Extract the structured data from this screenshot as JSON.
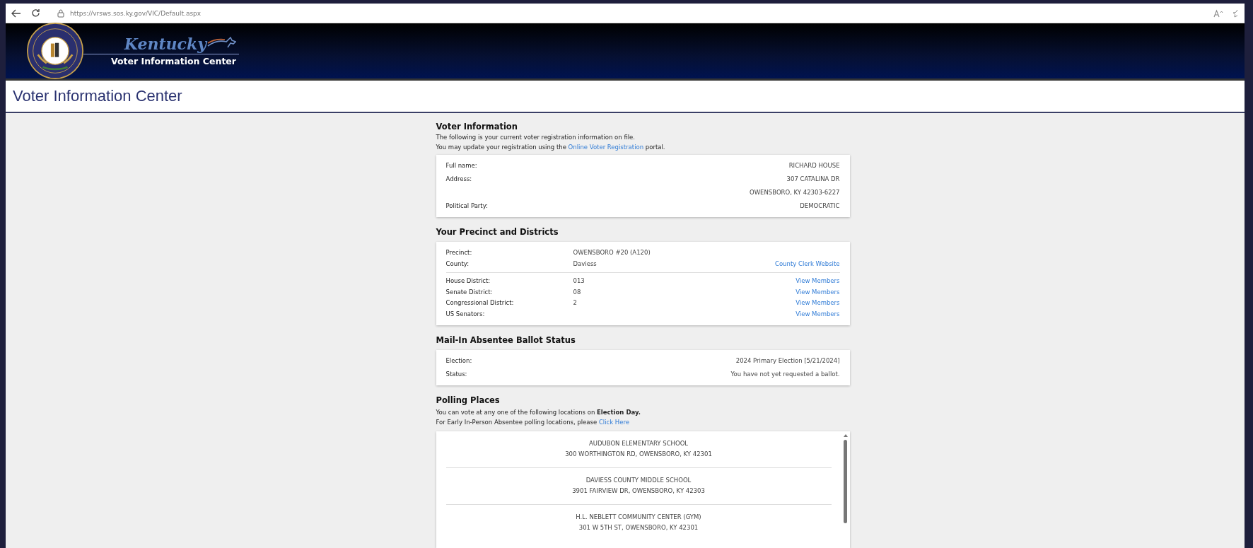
{
  "browser": {
    "url": "https://vrsws.sos.ky.gov/VIC/Default.aspx"
  },
  "header": {
    "wordmark": "Kentucky",
    "subtitle": "Voter Information Center"
  },
  "page_title": "Voter Information Center",
  "voter_information": {
    "heading": "Voter Information",
    "intro": "The following is your current voter registration information on file.",
    "update_before": "You may update your registration using the",
    "update_link": "Online Voter Registration",
    "update_after": "portal.",
    "fields": [
      {
        "label": "Full name:",
        "values": [
          "RICHARD  HOUSE"
        ]
      },
      {
        "label": "Address:",
        "values": [
          "307 CATALINA DR",
          "OWENSBORO, KY 42303-6227"
        ]
      },
      {
        "label": "Political Party:",
        "values": [
          "DEMOCRATIC"
        ]
      }
    ]
  },
  "precinct": {
    "heading": "Your Precinct and Districts",
    "groups": [
      [
        {
          "label": "Precinct:",
          "value": "OWENSBORO #20 (A120)"
        },
        {
          "label": "County:",
          "value": "Daviess",
          "link": "County Clerk Website"
        }
      ],
      [
        {
          "label": "House District:",
          "value": "013",
          "link": "View Members"
        },
        {
          "label": "Senate District:",
          "value": "08",
          "link": "View Members"
        },
        {
          "label": "Congressional District:",
          "value": "2",
          "link": "View Members"
        },
        {
          "label": "US Senators:",
          "link": "View Members"
        }
      ]
    ]
  },
  "absentee": {
    "heading": "Mail-In Absentee Ballot Status",
    "rows": [
      {
        "label": "Election:",
        "value": "2024 Primary Election [5/21/2024]"
      },
      {
        "label": "Status:",
        "value": "You have not yet requested a ballot."
      }
    ]
  },
  "polling": {
    "heading": "Polling Places",
    "intro": "You can vote at any one of the following locations on **Election Day.**",
    "early_before": "For Early In-Person Absentee polling locations, please",
    "early_link": "Click Here",
    "places": [
      {
        "name": "AUDUBON ELEMENTARY SCHOOL",
        "address": "300 WORTHINGTON RD, OWENSBORO, KY 42301"
      },
      {
        "name": "DAVIESS COUNTY MIDDLE SCHOOL",
        "address": "3901 FAIRVIEW DR, OWENSBORO, KY 42303"
      },
      {
        "name": "H.L. NEBLETT COMMUNITY CENTER (GYM)",
        "address": "301 W 5TH ST, OWENSBORO, KY 42301"
      }
    ]
  }
}
